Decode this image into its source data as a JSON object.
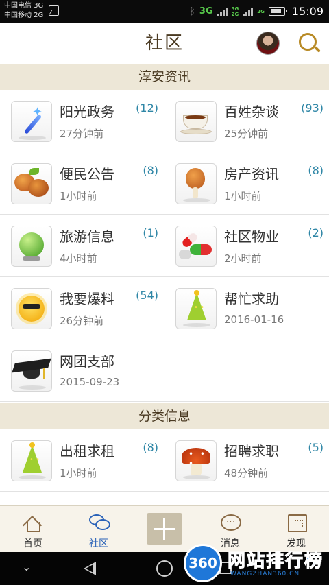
{
  "status_bar": {
    "carrier_1": "中国电信 3G",
    "carrier_2": "中国移动 2G",
    "network_main": "3G",
    "network_small_top": "3G",
    "network_small_bottom": "2G",
    "network_small_2": "2G",
    "time": "15:09"
  },
  "header": {
    "title": "社区"
  },
  "sections": [
    {
      "title": "淳安资讯",
      "items": [
        {
          "label": "阳光政务",
          "time": "27分钟前",
          "count": "(12)",
          "icon": "magic-wand-icon"
        },
        {
          "label": "百姓杂谈",
          "time": "25分钟前",
          "count": "(93)",
          "icon": "coffee-cup-icon"
        },
        {
          "label": "便民公告",
          "time": "1小时前",
          "count": "(8)",
          "icon": "sweet-potato-icon"
        },
        {
          "label": "房产资讯",
          "time": "1小时前",
          "count": "(8)",
          "icon": "drumstick-icon"
        },
        {
          "label": "旅游信息",
          "time": "4小时前",
          "count": "(1)",
          "icon": "globe-icon"
        },
        {
          "label": "社区物业",
          "time": "2小时前",
          "count": "(2)",
          "icon": "pills-icon"
        },
        {
          "label": "我要爆料",
          "time": "26分钟前",
          "count": "(54)",
          "icon": "sun-icon"
        },
        {
          "label": "帮忙求助",
          "time": "2016-01-16",
          "count": "",
          "icon": "party-hat-icon"
        },
        {
          "label": "网团支部",
          "time": "2015-09-23",
          "count": "",
          "icon": "graduation-cap-icon"
        }
      ]
    },
    {
      "title": "分类信息",
      "items": [
        {
          "label": "出租求租",
          "time": "1小时前",
          "count": "(8)",
          "icon": "party-hat-icon"
        },
        {
          "label": "招聘求职",
          "time": "48分钟前",
          "count": "(5)",
          "icon": "mushroom-icon"
        }
      ]
    }
  ],
  "tabbar": {
    "tabs": [
      {
        "label": "首页",
        "icon": "home-icon"
      },
      {
        "label": "社区",
        "icon": "chat-bubbles-icon",
        "active": true
      },
      {
        "label": "",
        "icon": "plus-icon"
      },
      {
        "label": "消息",
        "icon": "message-icon"
      },
      {
        "label": "发现",
        "icon": "map-icon"
      }
    ]
  },
  "watermark": {
    "badge": "360",
    "text": "网站排行榜",
    "sub": "WANGZHAN360.CN"
  },
  "colors": {
    "accent": "#b88a25",
    "section_bg": "#ede7d7",
    "count": "#2e86a6",
    "active_tab": "#2a62b8"
  }
}
